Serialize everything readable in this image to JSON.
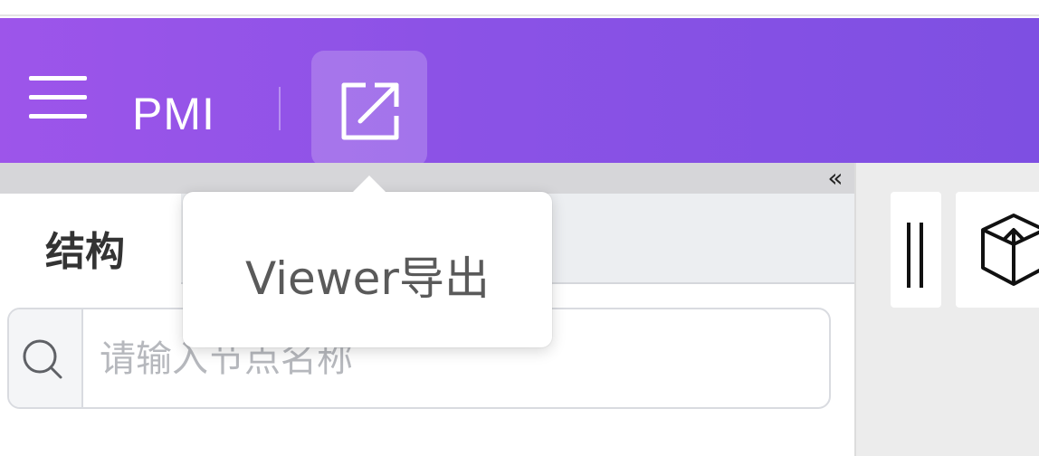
{
  "header": {
    "title": "PMI",
    "menu_icon": "hamburger-menu-icon",
    "export_icon": "export-arrow-icon",
    "colors": {
      "gradient_start": "#9d55ea",
      "gradient_end": "#7e4fe2"
    }
  },
  "tooltip": {
    "text": "Viewer导出"
  },
  "left_panel": {
    "collapse_icon": "double-chevron-left-icon",
    "collapse_glyph": "«",
    "tabs": [
      {
        "label": "结构",
        "active": true
      }
    ],
    "search": {
      "placeholder": "请输入节点名称",
      "value": "",
      "icon": "search-icon"
    }
  },
  "toolbar": {
    "items": [
      {
        "icon": "double-line-icon"
      },
      {
        "icon": "cube-arrow-icon"
      }
    ]
  }
}
